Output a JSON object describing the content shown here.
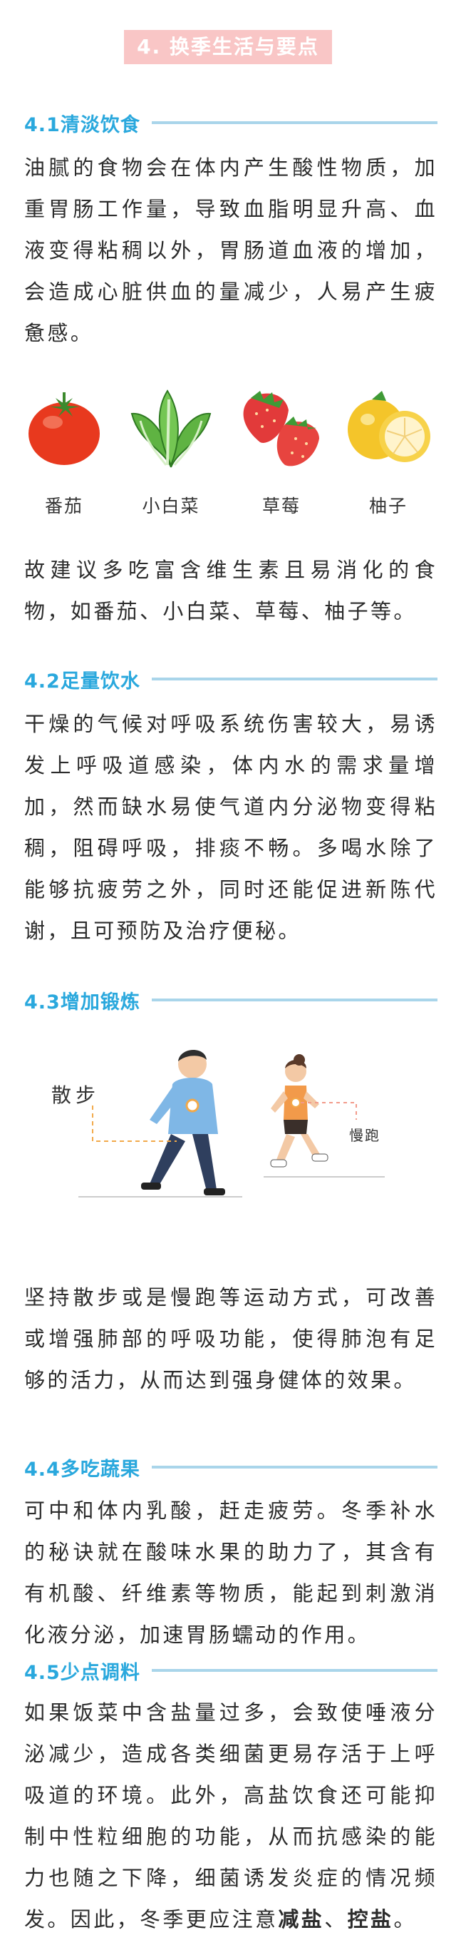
{
  "title": "4. 换季生活与要点",
  "sections": [
    {
      "heading": "4.1清淡饮食",
      "text": "油腻的食物会在体内产生酸性物质，加重胃肠工作量，导致血脂明显升高、血液变得粘稠以外，胃肠道血液的增加，会造成心脏供血的量减少，人易产生疲惫感。",
      "after_text": "故建议多吃富含维生素且易消化的食物，如番茄、小白菜、草莓、柚子等。"
    },
    {
      "heading": "4.2足量饮水",
      "text": "干燥的气候对呼吸系统伤害较大，易诱发上呼吸道感染，体内水的需求量增加，然而缺水易使气道内分泌物变得粘稠，阻碍呼吸，排痰不畅。多喝水除了能够抗疲劳之外，同时还能促进新陈代谢，且可预防及治疗便秘。"
    },
    {
      "heading": "4.3增加锻炼",
      "text": "坚持散步或是慢跑等运动方式，可改善或增强肺部的呼吸功能，使得肺泡有足够的活力，从而达到强身健体的效果。"
    },
    {
      "heading": "4.4多吃蔬果",
      "text": "可中和体内乳酸，赶走疲劳。冬季补水的秘诀就在酸味水果的助力了，其含有有机酸、纤维素等物质，能起到刺激消化液分泌，加速胃肠蠕动的作用。"
    },
    {
      "heading": "4.5少点调料",
      "text": "如果饭菜中含盐量过多，会致使唾液分泌减少，造成各类细菌更易存活于上呼吸道的环境。此外，高盐饮食还可能抑制中性粒细胞的功能，从而抗感染的能力也随之下降，细菌诱发炎症的情况频发。因此，冬季更应注意",
      "em1": "减盐",
      "sep": "、",
      "em2": "控盐",
      "end": "。"
    }
  ],
  "foods": [
    {
      "label": "番茄",
      "icon": "tomato-icon"
    },
    {
      "label": "小白菜",
      "icon": "bok-choy-icon"
    },
    {
      "label": "草莓",
      "icon": "strawberry-icon"
    },
    {
      "label": "柚子",
      "icon": "pomelo-icon"
    }
  ],
  "exercise": {
    "walk_label": "散步",
    "jog_label": "慢跑"
  },
  "colors": {
    "heading": "#2aa8dd",
    "rule": "#a9d5ea",
    "badge": "#f9c6c6"
  }
}
